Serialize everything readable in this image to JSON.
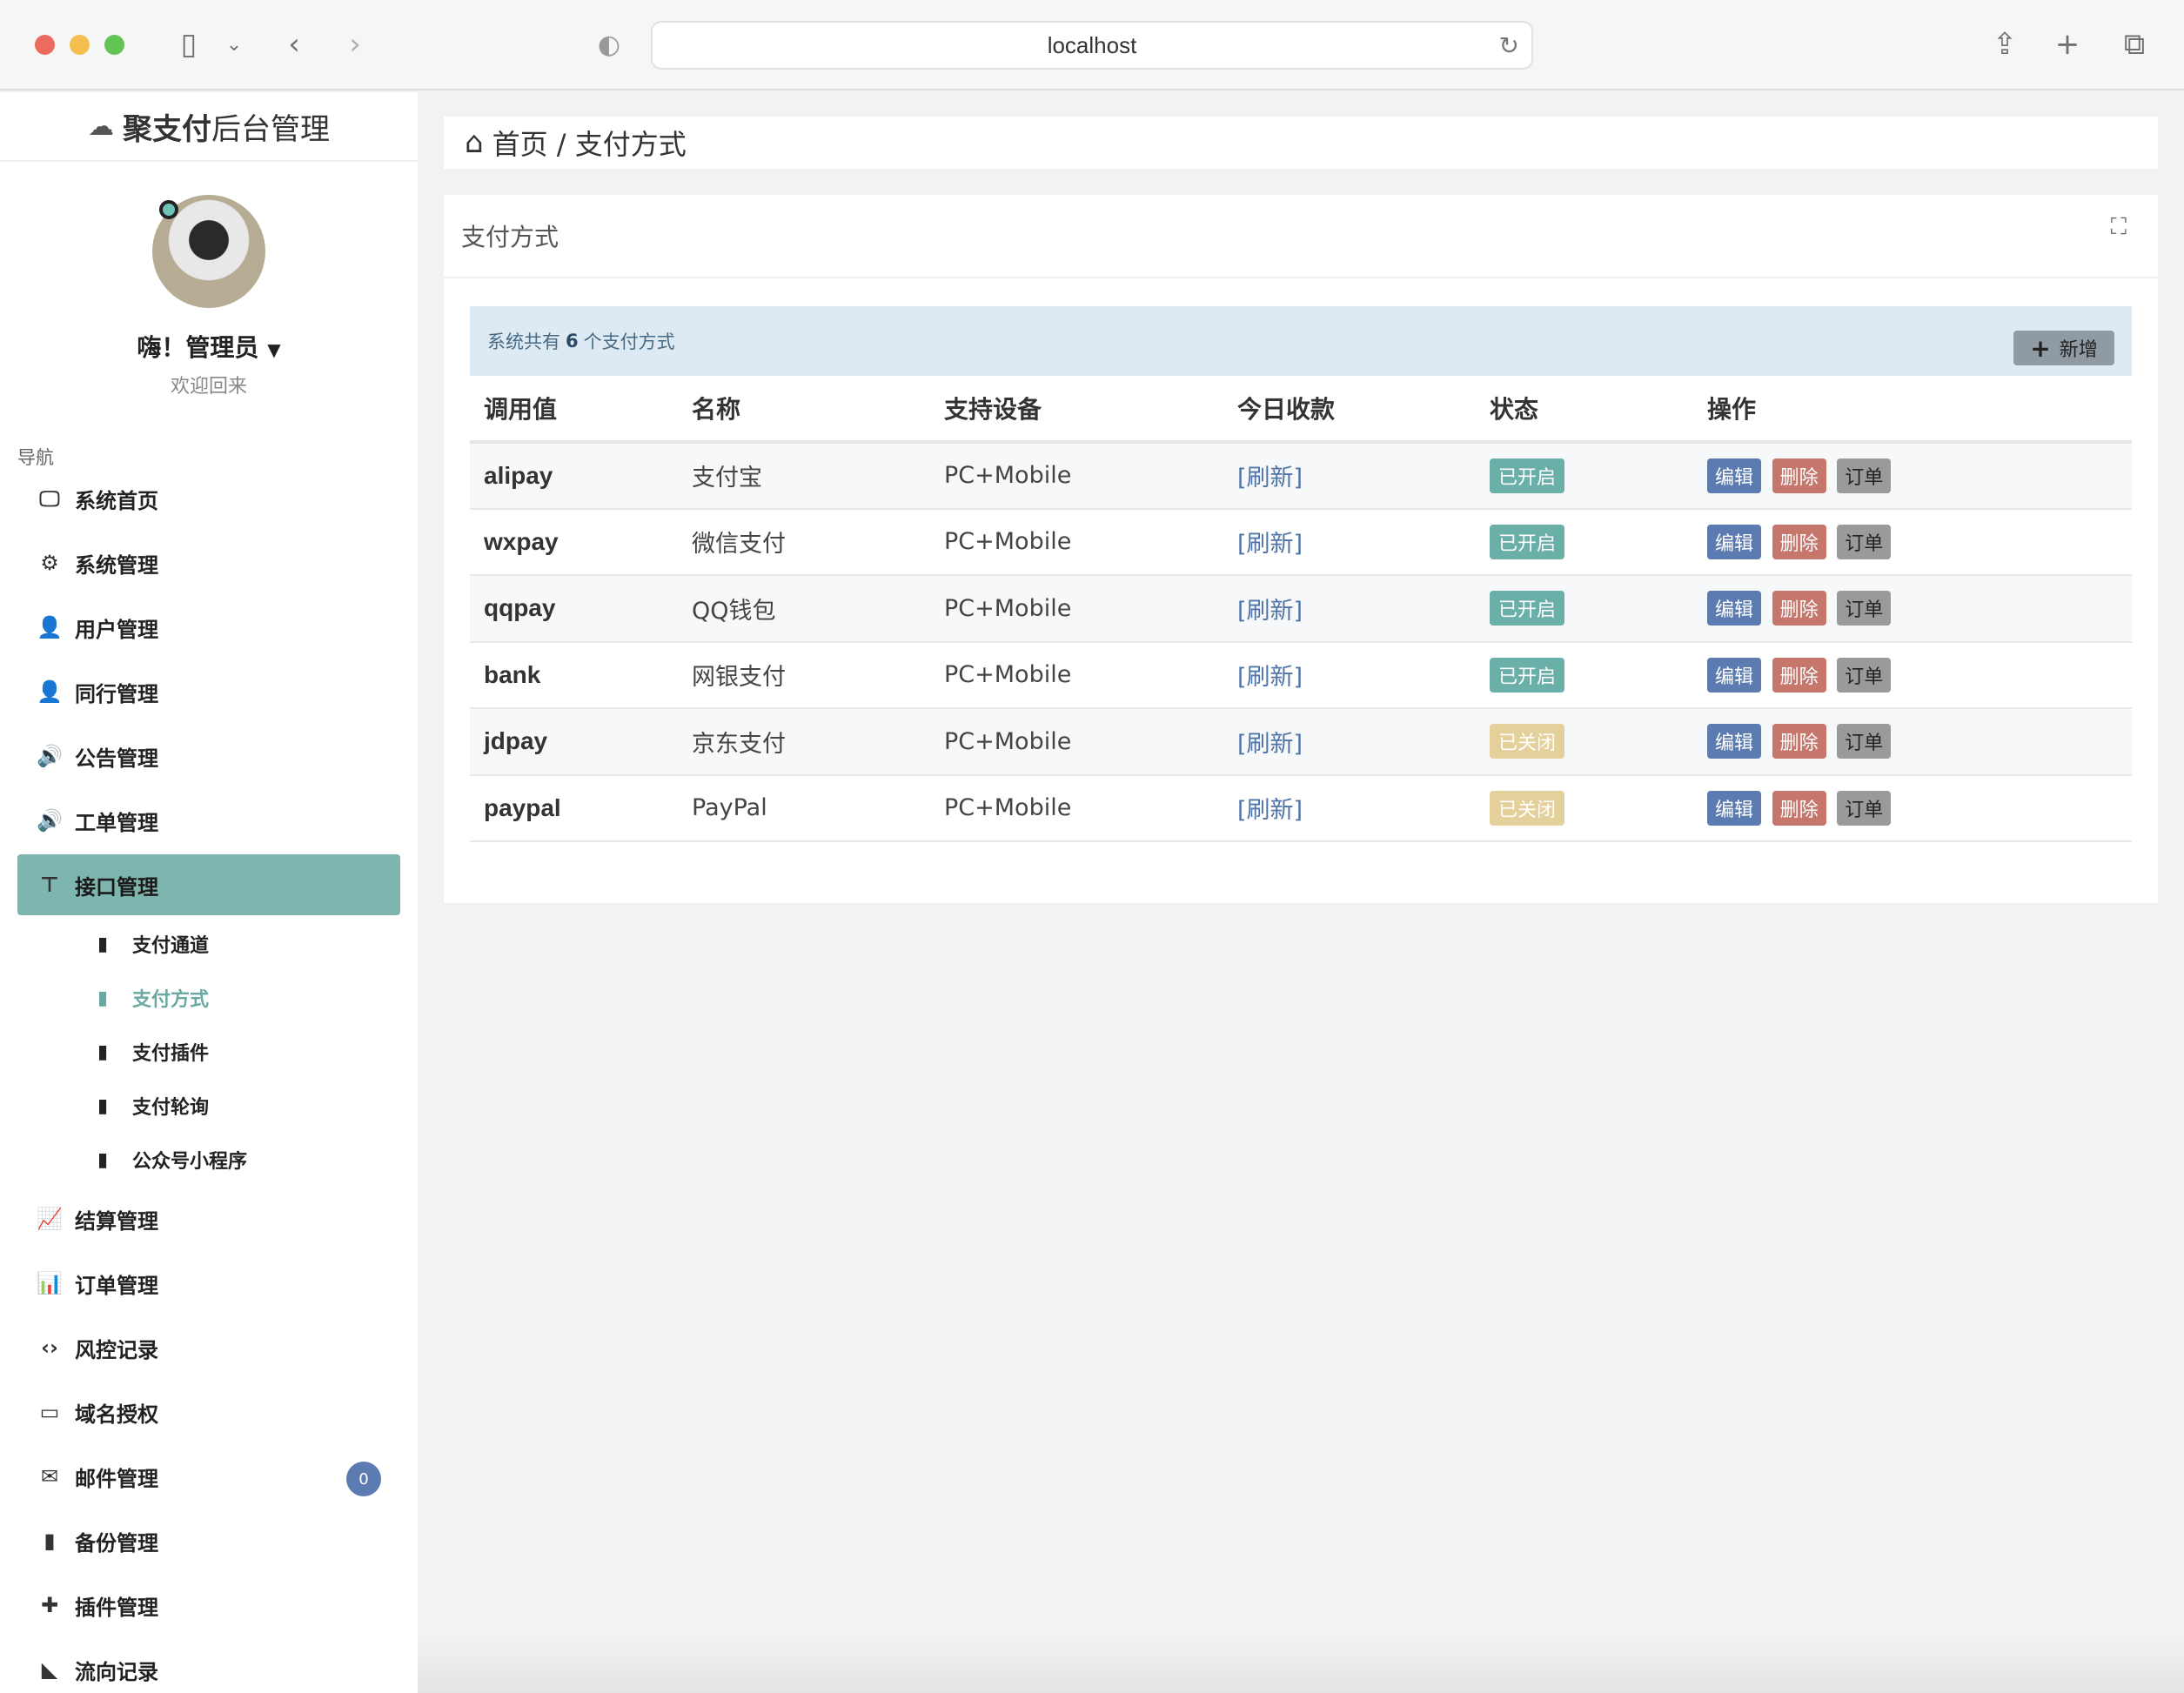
{
  "browser": {
    "url": "localhost"
  },
  "sidebar": {
    "brand_bold": "聚支付",
    "brand_rest": "后台管理",
    "user": "嗨！管理员",
    "welcome": "欢迎回来",
    "nav_heading": "导航",
    "items": [
      {
        "label": "系统首页",
        "icon": "monitor-icon"
      },
      {
        "label": "系统管理",
        "icon": "gears-icon"
      },
      {
        "label": "用户管理",
        "icon": "user-icon"
      },
      {
        "label": "同行管理",
        "icon": "user-icon"
      },
      {
        "label": "公告管理",
        "icon": "speaker-icon"
      },
      {
        "label": "工单管理",
        "icon": "speaker-icon"
      },
      {
        "label": "接口管理",
        "icon": "sitemap-icon"
      }
    ],
    "subitems": [
      {
        "label": "支付通道"
      },
      {
        "label": "支付方式"
      },
      {
        "label": "支付插件"
      },
      {
        "label": "支付轮询"
      },
      {
        "label": "公众号小程序"
      }
    ],
    "items2": [
      {
        "label": "结算管理",
        "icon": "line-chart-icon"
      },
      {
        "label": "订单管理",
        "icon": "bar-chart-icon"
      },
      {
        "label": "风控记录",
        "icon": "code-icon"
      },
      {
        "label": "域名授权",
        "icon": "card-icon"
      },
      {
        "label": "邮件管理",
        "icon": "mail-icon",
        "badge": "0"
      },
      {
        "label": "备份管理",
        "icon": "file-icon"
      },
      {
        "label": "插件管理",
        "icon": "puzzle-icon"
      },
      {
        "label": "流向记录",
        "icon": "area-chart-icon"
      }
    ]
  },
  "breadcrumb": "首页 / 支付方式",
  "panel": {
    "title": "支付方式",
    "info_prefix": "系统共有",
    "info_count": "6",
    "info_suffix": "个支付方式",
    "add_label": "新增"
  },
  "table": {
    "headers": [
      "调用值",
      "名称",
      "支持设备",
      "今日收款",
      "状态",
      "操作"
    ],
    "rows": [
      {
        "key": "alipay",
        "name": "支付宝",
        "device": "PC+Mobile",
        "today": "[刷新]",
        "status": "已开启",
        "on": true
      },
      {
        "key": "wxpay",
        "name": "微信支付",
        "device": "PC+Mobile",
        "today": "[刷新]",
        "status": "已开启",
        "on": true
      },
      {
        "key": "qqpay",
        "name": "QQ钱包",
        "device": "PC+Mobile",
        "today": "[刷新]",
        "status": "已开启",
        "on": true
      },
      {
        "key": "bank",
        "name": "网银支付",
        "device": "PC+Mobile",
        "today": "[刷新]",
        "status": "已开启",
        "on": true
      },
      {
        "key": "jdpay",
        "name": "京东支付",
        "device": "PC+Mobile",
        "today": "[刷新]",
        "status": "已关闭",
        "on": false
      },
      {
        "key": "paypal",
        "name": "PayPal",
        "device": "PC+Mobile",
        "today": "[刷新]",
        "status": "已关闭",
        "on": false
      }
    ],
    "ops": {
      "edit": "编辑",
      "del": "删除",
      "order": "订单"
    }
  }
}
